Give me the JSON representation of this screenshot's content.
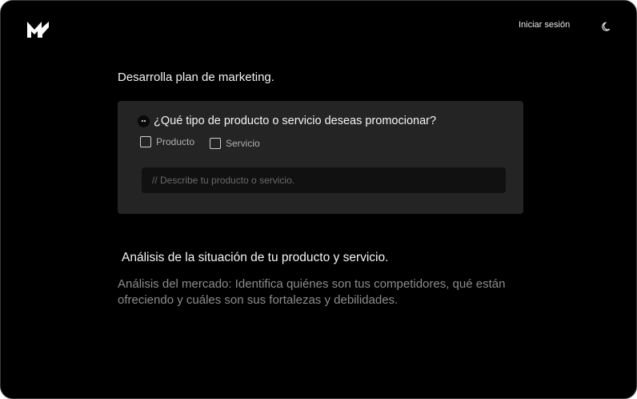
{
  "header": {
    "logo_icon": "mm-logo-icon",
    "login_label": "Iniciar sesión",
    "theme_icon": "moon-icon"
  },
  "page": {
    "title": "Desarrolla plan de marketing."
  },
  "question_card": {
    "icon": "bot-face-icon",
    "question": "¿Qué tipo de producto o servicio deseas promocionar?",
    "options": [
      {
        "label": "Producto",
        "checked": false
      },
      {
        "label": "Servicio",
        "checked": false
      }
    ],
    "input": {
      "value": "",
      "placeholder": "// Describe tu producto o servicio."
    }
  },
  "analysis": {
    "heading": "Análisis de la situación de tu producto y servicio.",
    "body": "Análisis del mercado: Identifica quiénes son tus competidores, qué están ofreciendo y cuáles son sus fortalezas y debilidades."
  },
  "colors": {
    "background": "#000000",
    "card": "#242424",
    "input": "#111111",
    "muted_text": "#8c8c8c"
  }
}
